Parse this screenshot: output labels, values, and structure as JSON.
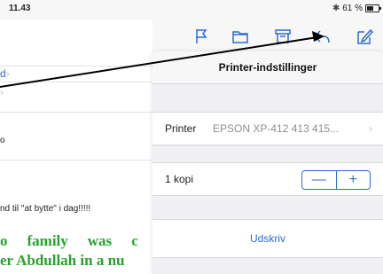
{
  "status": {
    "time": "11.43",
    "battery": "61 %",
    "battery_level": 0.61
  },
  "left": {
    "link1": "d",
    "row3": "o",
    "message_line": "nd til \"at bytte\" i dag!!!!!",
    "green_words": [
      "o",
      "family",
      "was",
      "c"
    ],
    "green_line2": "er Abdullah in a nu"
  },
  "toolbar": {
    "icons": [
      "flag-icon",
      "folder-icon",
      "archive-icon",
      "reply-icon",
      "compose-icon"
    ],
    "accent": "#2c6bd1"
  },
  "popover": {
    "title": "Printer-indstillinger",
    "printer_label": "Printer",
    "printer_value": "EPSON XP-412 413 415...",
    "copies_label": "1 kopi",
    "minus": "—",
    "plus": "+",
    "print_button": "Udskriv"
  }
}
